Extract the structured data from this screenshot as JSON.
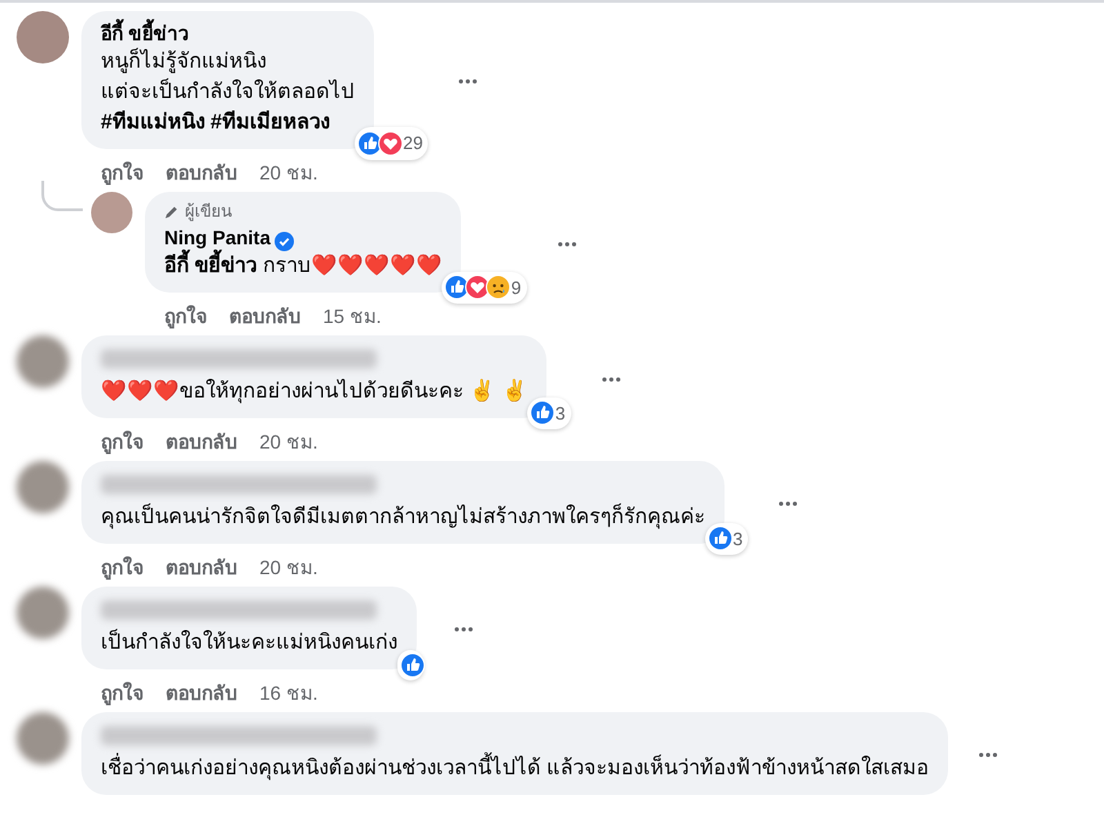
{
  "comments": [
    {
      "name": "อีกี้ ขยี้ข่าว",
      "name_hidden": false,
      "lines": [
        "หนูก็ไม่รู้จักแม่หนิง",
        "แต่จะเป็นกำลังใจให้ตลอดไป",
        "**#ทีมแม่หนิง #ทีมเมียหลวง**"
      ],
      "reactions": {
        "icons": [
          {
            "kind": "like"
          },
          {
            "kind": "love"
          }
        ],
        "count": "29"
      },
      "actions": [
        "ถูกใจ",
        "ตอบกลับ"
      ],
      "time": "20 ชม.",
      "children": [
        {
          "author_label": "ผู้เขียน",
          "name": "Ning Panita",
          "verified": true,
          "name_hidden": false,
          "lines": [
            "**อีกี้ ขยี้ข่าว** กราบ❤️❤️❤️❤️❤️"
          ],
          "reactions": {
            "icons": [
              {
                "kind": "like"
              },
              {
                "kind": "love"
              },
              {
                "kind": "sad"
              }
            ],
            "count": "9"
          },
          "actions": [
            "ถูกใจ",
            "ตอบกลับ"
          ],
          "time": "15 ชม."
        }
      ]
    },
    {
      "name_hidden": true,
      "lines": [
        "❤️❤️❤️ขอให้ทุกอย่างผ่านไปด้วยดีนะคะ ✌️ ✌️"
      ],
      "reactions": {
        "icons": [
          {
            "kind": "like"
          }
        ],
        "count": "3"
      },
      "actions": [
        "ถูกใจ",
        "ตอบกลับ"
      ],
      "time": "20 ชม."
    },
    {
      "name_hidden": true,
      "lines": [
        "คุณเป็นคนน่ารักจิตใจดีมีเมตตากล้าหาญไม่สร้างภาพใครๆก็รักคุณค่ะ"
      ],
      "reactions": {
        "icons": [
          {
            "kind": "like"
          }
        ],
        "count": "3"
      },
      "actions": [
        "ถูกใจ",
        "ตอบกลับ"
      ],
      "time": "20 ชม."
    },
    {
      "name_hidden": true,
      "lines": [
        "เป็นกำลังใจให้นะคะแม่หนิงคนเก่ง"
      ],
      "reactions": {
        "icons": [
          {
            "kind": "like"
          }
        ]
      },
      "actions": [
        "ถูกใจ",
        "ตอบกลับ"
      ],
      "time": "16 ชม."
    },
    {
      "name_hidden": true,
      "lines": [
        "เชื่อว่าคนเก่งอย่างคุณหนิงต้องผ่านช่วงเวลานี้ไปได้ แล้วจะมองเห็นว่าท้องฟ้าข้างหน้าสดใสเสมอ"
      ]
    }
  ]
}
